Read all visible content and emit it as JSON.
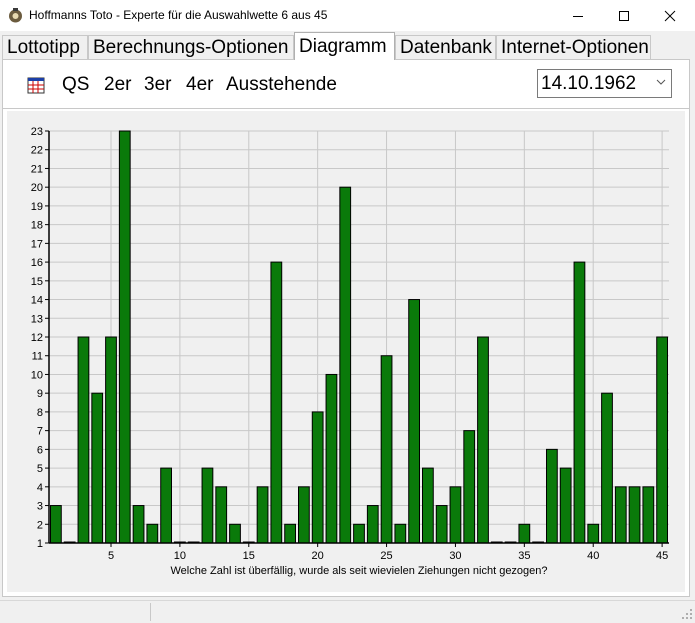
{
  "window": {
    "title": "Hoffmanns Toto - Experte für die Auswahlwette 6 aus 45"
  },
  "tabs": [
    {
      "label": "Lottotipp"
    },
    {
      "label": "Berechnungs-Optionen"
    },
    {
      "label": "Diagramm"
    },
    {
      "label": "Datenbank"
    },
    {
      "label": "Internet-Optionen"
    }
  ],
  "active_tab": "Diagramm",
  "toolbar": {
    "qs_label": "QS",
    "zweier_label": "2er",
    "dreier_label": "3er",
    "vierer_label": "4er",
    "ausstehende_label": "Ausstehende"
  },
  "date_select": {
    "value": "14.10.1962"
  },
  "colors": {
    "bar_fill": "#0a7a0a",
    "bar_border": "#000000",
    "grid": "#c8c8c8",
    "plot_bg": "#f0f0f0"
  },
  "chart_data": {
    "type": "bar",
    "xlabel": "Welche Zahl ist überfällig, wurde als seit wievielen Ziehungen nicht gezogen?",
    "ylabel": "",
    "categories": [
      1,
      2,
      3,
      4,
      5,
      6,
      7,
      8,
      9,
      10,
      11,
      12,
      13,
      14,
      15,
      16,
      17,
      18,
      19,
      20,
      21,
      22,
      23,
      24,
      25,
      26,
      27,
      28,
      29,
      30,
      31,
      32,
      33,
      34,
      35,
      36,
      37,
      38,
      39,
      40,
      41,
      42,
      43,
      44,
      45
    ],
    "values": [
      3,
      1,
      12,
      9,
      12,
      23,
      3,
      2,
      5,
      1,
      1,
      5,
      4,
      2,
      1,
      4,
      16,
      2,
      4,
      8,
      10,
      20,
      2,
      3,
      11,
      2,
      14,
      5,
      3,
      4,
      7,
      12,
      1,
      1,
      2,
      1,
      6,
      5,
      16,
      2,
      9,
      4,
      4,
      4,
      12
    ],
    "x_tick_labels": [
      5,
      10,
      15,
      20,
      25,
      30,
      35,
      40,
      45
    ],
    "y_tick_labels": [
      1,
      2,
      3,
      4,
      5,
      6,
      7,
      8,
      9,
      10,
      11,
      12,
      13,
      14,
      15,
      16,
      17,
      18,
      19,
      20,
      21,
      22,
      23
    ],
    "ylim": [
      1,
      23
    ],
    "grid": true,
    "legend": "none"
  }
}
